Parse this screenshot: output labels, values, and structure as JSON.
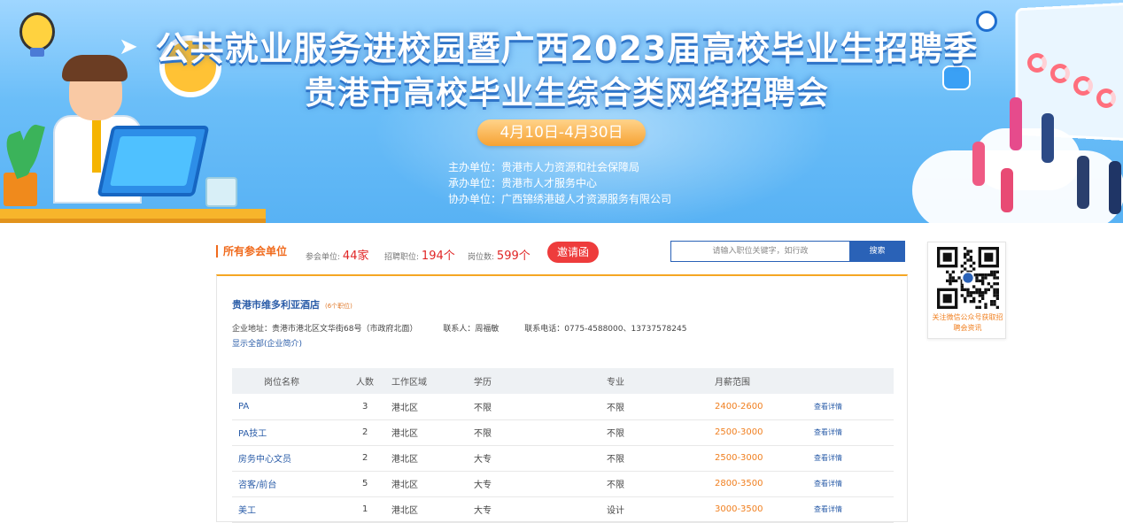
{
  "banner": {
    "title_line1": "公共就业服务进校园暨广西2023届高校毕业生招聘季",
    "title_line2": "贵港市高校毕业生综合类网络招聘会",
    "date_range": "4月10日-4月30日",
    "host": "主办单位：贵港市人力资源和社会保障局",
    "organizer": "承办单位：贵港市人才服务中心",
    "co_organizer": "协办单位：广西锦绣港越人才资源服务有限公司"
  },
  "summary": {
    "all_units_label": "所有参会单位",
    "units_label": "参会单位:",
    "units_value": "44家",
    "positions_label": "招聘职位:",
    "positions_value": "194个",
    "openings_label": "岗位数:",
    "openings_value": "599个",
    "invite_label": "邀请函"
  },
  "search": {
    "placeholder": "请输入职位关键字，如行政",
    "button_label": "搜索"
  },
  "company": {
    "name": "贵港市维多利亚酒店",
    "position_count": "(6个职位)",
    "address": "企业地址：贵港市港北区文华街68号（市政府北面）",
    "contact": "联系人：周福敏",
    "phone": "联系电话：0775-4588000、13737578245",
    "show_all": "显示全部(企业简介)"
  },
  "table": {
    "headers": [
      "岗位名称",
      "人数",
      "工作区域",
      "学历",
      "专业",
      "月薪范围",
      ""
    ],
    "rows": [
      {
        "name": "PA",
        "count": "3",
        "area": "港北区",
        "edu": "不限",
        "major": "不限",
        "salary": "2400-2600",
        "detail": "查看详情"
      },
      {
        "name": "PA技工",
        "count": "2",
        "area": "港北区",
        "edu": "不限",
        "major": "不限",
        "salary": "2500-3000",
        "detail": "查看详情"
      },
      {
        "name": "房务中心文员",
        "count": "2",
        "area": "港北区",
        "edu": "大专",
        "major": "不限",
        "salary": "2500-3000",
        "detail": "查看详情"
      },
      {
        "name": "咨客/前台",
        "count": "5",
        "area": "港北区",
        "edu": "大专",
        "major": "不限",
        "salary": "2800-3500",
        "detail": "查看详情"
      },
      {
        "name": "美工",
        "count": "1",
        "area": "港北区",
        "edu": "大专",
        "major": "设计",
        "salary": "3000-3500",
        "detail": "查看详情"
      }
    ]
  },
  "qr": {
    "caption": "关注微信公众号获取招聘会资讯"
  },
  "colors": {
    "accent_orange": "#f06a1c",
    "link_blue": "#2a5ca8",
    "invite_red": "#ee3c3c",
    "salary_orange": "#f07f1f"
  }
}
